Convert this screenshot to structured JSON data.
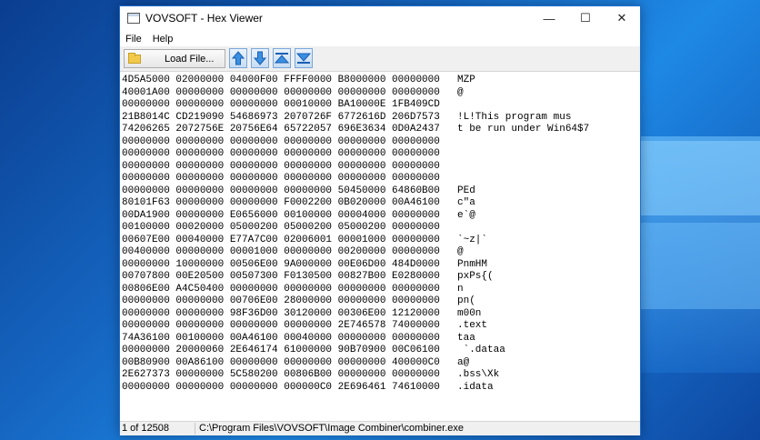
{
  "window": {
    "title": "VOVSOFT - Hex Viewer"
  },
  "titlebar": {
    "minimize": "—",
    "maximize": "☐",
    "close": "✕"
  },
  "menu": {
    "file": "File",
    "help": "Help"
  },
  "toolbar": {
    "load_label": "Load File...",
    "nav_icons": [
      "arrow-up-icon",
      "arrow-down-icon",
      "go-top-icon",
      "go-bottom-icon"
    ]
  },
  "hex_rows": [
    "4D5A5000 02000000 04000F00 FFFF0000 B8000000 00000000",
    "40001A00 00000000 00000000 00000000 00000000 00000000",
    "00000000 00000000 00000000 00010000 BA10000E 1FB409CD",
    "21B8014C CD219090 54686973 2070726F 6772616D 206D7573",
    "74206265 2072756E 20756E64 65722057 696E3634 0D0A2437",
    "00000000 00000000 00000000 00000000 00000000 00000000",
    "00000000 00000000 00000000 00000000 00000000 00000000",
    "00000000 00000000 00000000 00000000 00000000 00000000",
    "00000000 00000000 00000000 00000000 00000000 00000000",
    "00000000 00000000 00000000 00000000 50450000 64860B00",
    "80101F63 00000000 00000000 F0002200 0B020000 00A46100",
    "00DA1900 00000000 E0656000 00100000 00004000 00000000",
    "00100000 00020000 05000200 05000200 05000200 00000000",
    "00607E00 00040000 E77A7C00 02006001 00001000 00000000",
    "00400000 00000000 00001000 00000000 00200000 00000000",
    "00000000 10000000 00506E00 9A000000 00E06D00 484D0000",
    "00707800 00E20500 00507300 F0130500 00827B00 E0280000",
    "00806E00 A4C50400 00000000 00000000 00000000 00000000",
    "00000000 00000000 00706E00 28000000 00000000 00000000",
    "00000000 00000000 98F36D00 30120000 00306E00 12120000",
    "00000000 00000000 00000000 00000000 2E746578 74000000",
    "74A36100 00100000 00A46100 00040000 00000000 00000000",
    "00000000 20000060 2E646174 61000000 90B70900 00C06100",
    "00B80900 00A86100 00000000 00000000 00000000 400000C0",
    "2E627373 00000000 5C580200 00806B00 00000000 00000000",
    "00000000 00000000 00000000 000000C0 2E696461 74610000"
  ],
  "ascii_rows": [
    "MZP",
    "@",
    "",
    "!L!This program mus",
    "t be run under Win64$7",
    "",
    "",
    "",
    "",
    "PEd",
    "c\"a",
    "e`@",
    "",
    "`~z|`",
    "@",
    "PnmHM",
    "pxPs{(",
    "n",
    "pn(",
    "m00n",
    ".text",
    "taa",
    " `.dataa",
    "a@",
    ".bss\\Xk",
    ".idata"
  ],
  "status": {
    "position": "1 of 12508",
    "file_path": "C:\\Program Files\\VOVSOFT\\Image Combiner\\combiner.exe"
  }
}
